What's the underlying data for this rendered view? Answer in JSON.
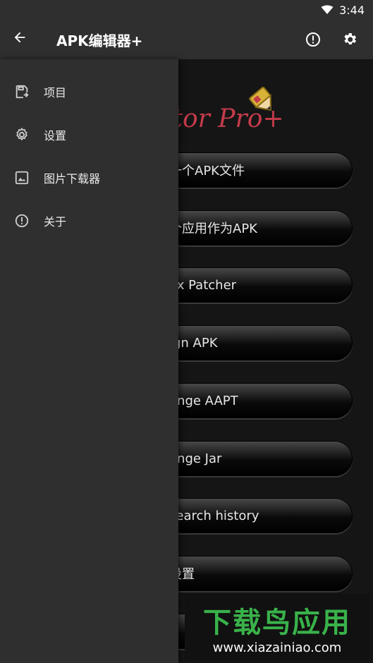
{
  "status": {
    "time": "3:44"
  },
  "topbar": {
    "title": "APK编辑器+",
    "back_icon": "arrow-back-icon",
    "actions": [
      {
        "name": "info-icon"
      },
      {
        "name": "gear-icon"
      }
    ]
  },
  "drawer": {
    "items": [
      {
        "label": "项目",
        "icon": "project-icon"
      },
      {
        "label": "设置",
        "icon": "gear-icon"
      },
      {
        "label": "图片下载器",
        "icon": "image-icon"
      },
      {
        "label": "关于",
        "icon": "info-icon"
      }
    ]
  },
  "underlay": {
    "logo_text": "itor Pro+",
    "buttons": [
      "一个APK文件",
      "个应用作为APK",
      "ex Patcher",
      "ign APK",
      "ange AAPT",
      "ange Jar",
      "search history",
      "设置"
    ]
  },
  "watermark": {
    "line1": "下载鸟应用",
    "line2": "www.xiazainiao.com"
  }
}
